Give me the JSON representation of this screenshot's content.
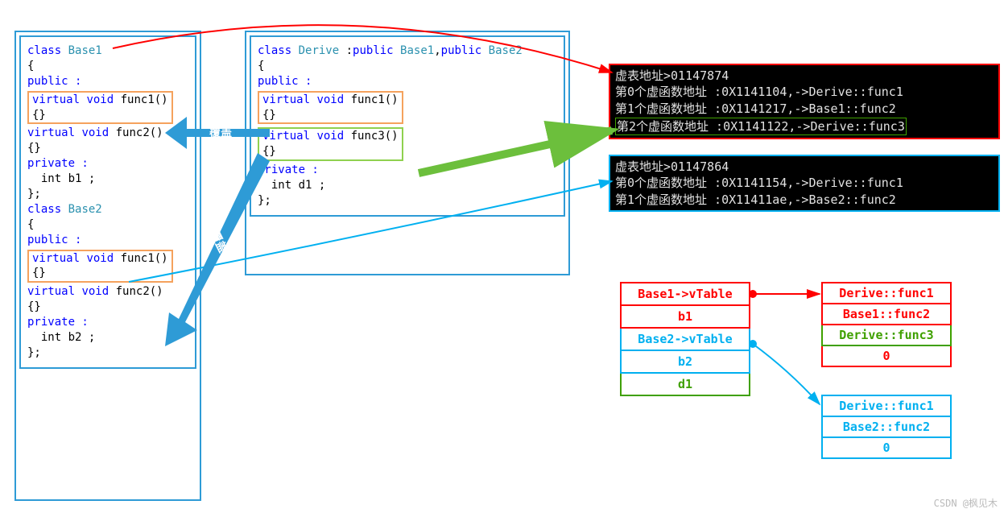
{
  "base1": {
    "decl": "class Base1",
    "vis1": "public :",
    "f1": "virtual void func1()",
    "f2": "virtual void func2()",
    "vis2": "private :",
    "m1": "  int b1 ;"
  },
  "base2": {
    "decl": "class Base2",
    "vis1": "public :",
    "f1": "virtual void func1()",
    "f2": "virtual void func2()",
    "vis2": "private :",
    "m1": "  int b2 ;"
  },
  "derive": {
    "decl": "class Derive :public Base1,public Base2",
    "vis1": "public :",
    "f1": "virtual void func1()",
    "f3": "virtual void func3()",
    "vis2": "private :",
    "m1": "  int d1 ;"
  },
  "arrow_labels": {
    "override": "覆盖",
    "override2": "覆盖"
  },
  "term1": {
    "l0": "虚表地址>01147874",
    "l1": "第0个虚函数地址 :0X1141104,->Derive::func1",
    "l2": "第1个虚函数地址 :0X1141217,->Base1::func2",
    "l3": "第2个虚函数地址 :0X1141122,->Derive::func3"
  },
  "term2": {
    "l0": "虚表地址>01147864",
    "l1": "第0个虚函数地址 :0X1141154,->Derive::func1",
    "l2": "第1个虚函数地址 :0X11411ae,->Base2::func2"
  },
  "mem": {
    "r0": "Base1->vTable",
    "r1": "b1",
    "r2": "Base2->vTable",
    "r3": "b2",
    "r4": "d1"
  },
  "vt1": {
    "r0": "Derive::func1",
    "r1": "Base1::func2",
    "r2": "Derive::func3",
    "r3": "0"
  },
  "vt2": {
    "r0": "Derive::func1",
    "r1": "Base2::func2",
    "r2": "0"
  },
  "footer": "CSDN @枫见木"
}
